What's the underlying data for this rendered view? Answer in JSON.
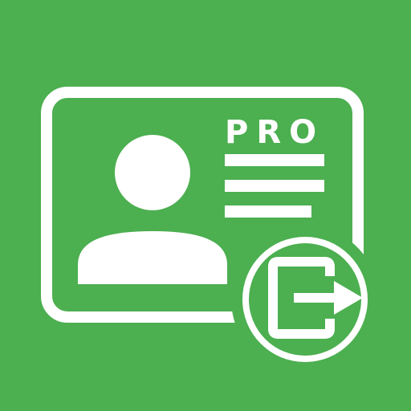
{
  "app_icon": {
    "badge_text": "PRO",
    "background_color": "#4caf50",
    "foreground_color": "#ffffff",
    "icons": {
      "card": "contact-card-icon",
      "avatar": "person-avatar-icon",
      "lines": "text-lines-icon",
      "export": "export-arrow-icon"
    }
  }
}
